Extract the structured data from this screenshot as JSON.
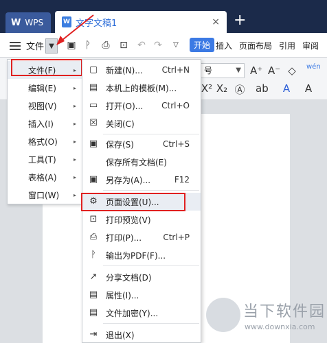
{
  "tabs": {
    "wps_label": "WPS",
    "doc_title": "文字文稿1",
    "close_glyph": "×",
    "new_glyph": "+"
  },
  "toolbar": {
    "file_label": "文件",
    "tabs": [
      "开始",
      "插入",
      "页面布局",
      "引用",
      "审阅"
    ],
    "active_tab": "开始"
  },
  "ribbon": {
    "font_size_value": "号"
  },
  "main_menu": {
    "items": [
      {
        "label": "文件(F)",
        "has_sub": true
      },
      {
        "label": "编辑(E)",
        "has_sub": true
      },
      {
        "label": "视图(V)",
        "has_sub": true
      },
      {
        "label": "插入(I)",
        "has_sub": true
      },
      {
        "label": "格式(O)",
        "has_sub": true
      },
      {
        "label": "工具(T)",
        "has_sub": true
      },
      {
        "label": "表格(A)",
        "has_sub": true
      },
      {
        "label": "窗口(W)",
        "has_sub": true
      }
    ],
    "submenu_glyph": "▸"
  },
  "file_menu": {
    "items": [
      {
        "label": "新建(N)...",
        "shortcut": "Ctrl+N",
        "icon": "new-doc-icon"
      },
      {
        "label": "本机上的模板(M)...",
        "shortcut": "",
        "icon": "template-icon"
      },
      {
        "label": "打开(O)...",
        "shortcut": "Ctrl+O",
        "icon": "folder-open-icon"
      },
      {
        "label": "关闭(C)",
        "shortcut": "",
        "icon": "close-doc-icon"
      },
      {
        "label": "保存(S)",
        "shortcut": "Ctrl+S",
        "icon": "save-icon"
      },
      {
        "label": "保存所有文档(E)",
        "shortcut": "",
        "icon": ""
      },
      {
        "label": "另存为(A)...",
        "shortcut": "F12",
        "icon": "save-as-icon"
      },
      {
        "label": "页面设置(U)...",
        "shortcut": "",
        "icon": "page-setup-icon"
      },
      {
        "label": "打印预览(V)",
        "shortcut": "",
        "icon": "print-preview-icon"
      },
      {
        "label": "打印(P)...",
        "shortcut": "Ctrl+P",
        "icon": "print-icon"
      },
      {
        "label": "输出为PDF(F)...",
        "shortcut": "",
        "icon": "export-pdf-icon"
      },
      {
        "label": "分享文档(D)",
        "shortcut": "",
        "icon": "share-icon"
      },
      {
        "label": "属性(I)...",
        "shortcut": "",
        "icon": "properties-icon"
      },
      {
        "label": "文件加密(Y)...",
        "shortcut": "",
        "icon": "encrypt-icon"
      },
      {
        "label": "退出(X)",
        "shortcut": "",
        "icon": "exit-icon"
      }
    ]
  },
  "watermark": {
    "name": "当下软件园",
    "url": "www.downxia.com"
  },
  "colors": {
    "accent": "#3c7ae4",
    "highlight_border": "#e02020",
    "titlebar": "#1b2a4a"
  }
}
